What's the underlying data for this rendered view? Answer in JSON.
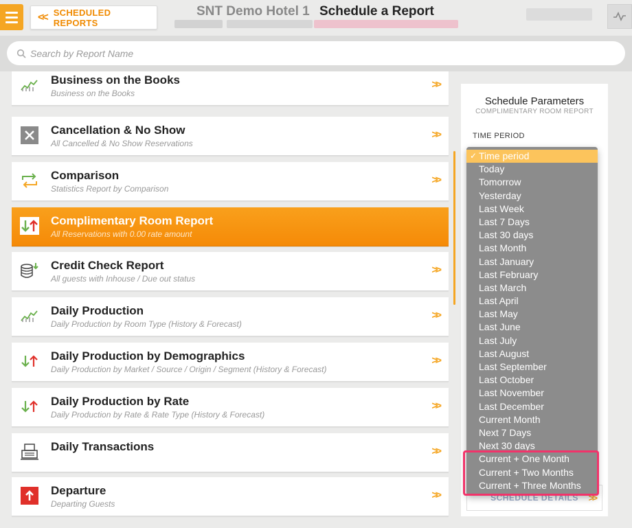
{
  "header": {
    "back_label": "SCHEDULED REPORTS",
    "hotel": "SNT Demo Hotel 1",
    "title": "Schedule a Report"
  },
  "search": {
    "placeholder": "Search by Report Name"
  },
  "reports": [
    {
      "title": "Business on the Books",
      "subtitle": "Business on the Books",
      "icon": "trend-chart-icon"
    },
    {
      "title": "Cancellation & No Show",
      "subtitle": "All Cancelled & No Show Reservations",
      "icon": "close-box-icon"
    },
    {
      "title": "Comparison",
      "subtitle": "Statistics Report by Comparison",
      "icon": "swap-arrows-icon"
    },
    {
      "title": "Complimentary Room Report",
      "subtitle": "All Reservations with 0.00 rate amount",
      "icon": "updown-arrows-icon"
    },
    {
      "title": "Credit Check Report",
      "subtitle": "All guests with Inhouse / Due out status",
      "icon": "coins-icon"
    },
    {
      "title": "Daily Production",
      "subtitle": "Daily Production by Room Type (History & Forecast)",
      "icon": "trend-chart-icon"
    },
    {
      "title": "Daily Production by Demographics",
      "subtitle": "Daily Production by Market / Source / Origin / Segment (History & Forecast)",
      "icon": "updown-arrows-icon"
    },
    {
      "title": "Daily Production by Rate",
      "subtitle": "Daily Production by Rate & Rate Type (History & Forecast)",
      "icon": "updown-arrows-icon"
    },
    {
      "title": "Daily Transactions",
      "subtitle": "",
      "icon": "register-icon"
    },
    {
      "title": "Departure",
      "subtitle": "Departing Guests",
      "icon": "up-arrow-box-icon"
    }
  ],
  "panel": {
    "title": "Schedule Parameters",
    "subtitle": "COMPLIMENTARY ROOM REPORT",
    "time_period_label": "TIME PERIOD",
    "schedule_button": "SCHEDULE DETAILS"
  },
  "dropdown": {
    "selected": "Time period",
    "options": [
      "Today",
      "Tomorrow",
      "Yesterday",
      "Last Week",
      "Last 7 Days",
      "Last 30 days",
      "Last Month",
      "Last January",
      "Last February",
      "Last March",
      "Last April",
      "Last May",
      "Last June",
      "Last July",
      "Last August",
      "Last September",
      "Last October",
      "Last November",
      "Last December",
      "Current Month",
      "Next 7 Days",
      "Next 30 days",
      "Current + One Month",
      "Current + Two Months",
      "Current + Three Months"
    ]
  },
  "colors": {
    "accent": "#f5a623",
    "highlight": "#f2336a"
  }
}
